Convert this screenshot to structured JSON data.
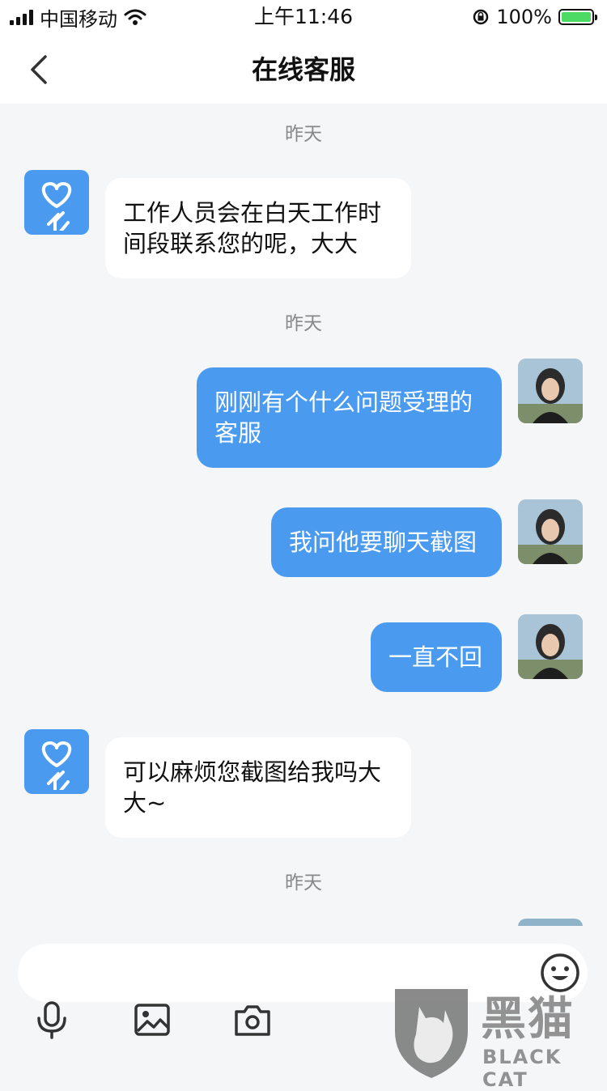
{
  "status_bar": {
    "carrier": "中国移动",
    "time": "上午11:46",
    "battery": "100%"
  },
  "nav": {
    "title": "在线客服"
  },
  "chat": {
    "time_labels": [
      "昨天",
      "昨天",
      "昨天"
    ],
    "messages": [
      {
        "side": "left",
        "sender": "service",
        "text": "工作人员会在白天工作时间段联系您的呢，大大"
      },
      {
        "side": "right",
        "sender": "user",
        "text": "刚刚有个什么问题受理的客服"
      },
      {
        "side": "right",
        "sender": "user",
        "text": "我问他要聊天截图"
      },
      {
        "side": "right",
        "sender": "user",
        "text": "一直不回"
      },
      {
        "side": "left",
        "sender": "service",
        "text": "可以麻烦您截图给我吗大大~"
      }
    ]
  },
  "input": {
    "value": "",
    "placeholder": ""
  },
  "toolbar": {
    "icons": [
      "microphone-icon",
      "image-icon",
      "camera-icon",
      "emoji-icon"
    ]
  },
  "watermark": {
    "text": "黑猫",
    "sub": "BLACK CAT"
  },
  "colors": {
    "accent": "#4a9bf0",
    "background": "#f4f6f8",
    "bubble_left": "#ffffff",
    "bubble_right": "#4a9bf0"
  }
}
